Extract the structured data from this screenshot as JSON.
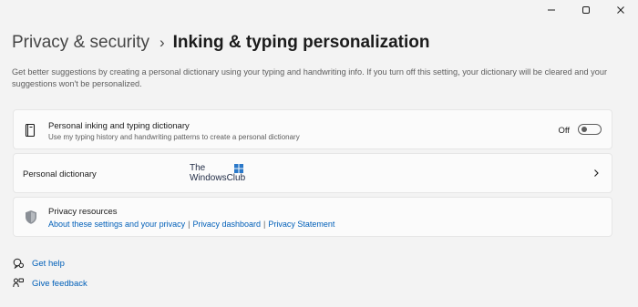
{
  "breadcrumb": {
    "parent": "Privacy & security",
    "separator": "›",
    "current": "Inking & typing personalization"
  },
  "description": "Get better suggestions by creating a personal dictionary using your typing and handwriting info. If you turn off this setting, your dictionary will be cleared and your suggestions won't be personalized.",
  "dictionary_setting": {
    "title": "Personal inking and typing dictionary",
    "subtitle": "Use my typing history and handwriting patterns to create a personal dictionary",
    "toggle_label": "Off",
    "enabled": false
  },
  "personal_dictionary": {
    "title": "Personal dictionary"
  },
  "watermark": {
    "line1": "The",
    "line2": "WindowsClub"
  },
  "privacy_resources": {
    "title": "Privacy resources",
    "links": [
      "About these settings and your privacy",
      "Privacy dashboard",
      "Privacy Statement"
    ],
    "separator": "|"
  },
  "help": {
    "get_help": "Get help",
    "give_feedback": "Give feedback"
  },
  "icons": {
    "minimize": "minimize-icon",
    "restore": "restore-icon",
    "close": "close-icon",
    "dictionary": "notebook-icon",
    "privacy": "shield-icon",
    "get_help": "help-chat-icon",
    "feedback": "feedback-icon",
    "chevron": "chevron-right-icon"
  },
  "colors": {
    "background": "#f3f3f3",
    "card": "#fbfbfb",
    "link": "#005fb8",
    "text": "#1b1b1b",
    "secondary_text": "#5d5d5d"
  }
}
